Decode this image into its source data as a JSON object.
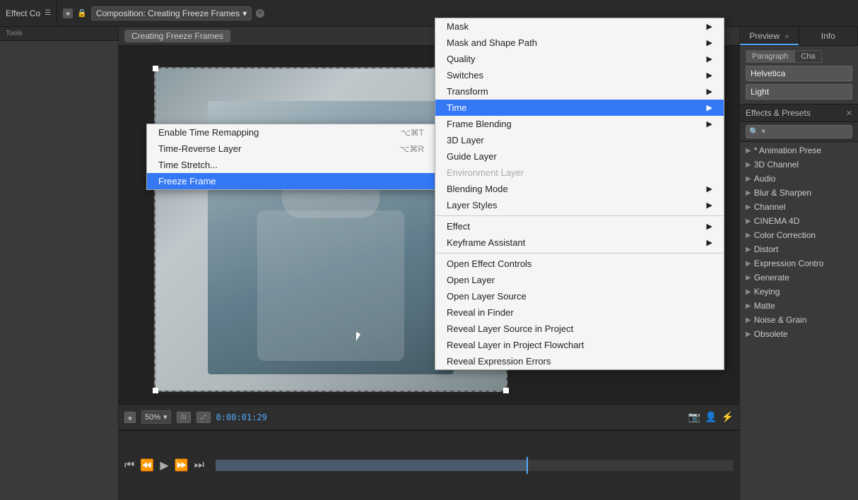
{
  "app": {
    "title": "Effect Co",
    "panel_menu_icon": "☰"
  },
  "top_bar": {
    "comp_icon_color": "#555",
    "lock_symbol": "🔒",
    "composition_name": "Composition: Creating Freeze Frames",
    "dropdown_arrow": "▾",
    "close_symbol": "✕"
  },
  "comp_tab": {
    "label": "Creating Freeze Frames"
  },
  "canvas": {
    "zoom_label": "50%",
    "timecode": "0:00:01:29",
    "camera_symbol": "📷",
    "person_symbol": "👤",
    "motion_symbol": "⚡"
  },
  "right_panel": {
    "tabs": [
      {
        "id": "preview",
        "label": "Preview",
        "has_close": true
      },
      {
        "id": "info",
        "label": "Info",
        "has_close": false
      }
    ],
    "font_tabs": [
      {
        "id": "paragraph",
        "label": "Paragraph"
      },
      {
        "id": "character",
        "label": "Cha"
      }
    ],
    "font_name": "Helvetica",
    "font_weight": "Light"
  },
  "effects_presets": {
    "title": "Effects & Presets",
    "close_symbol": "✕",
    "search_icon": "🔍",
    "search_arrow": "▾",
    "items": [
      {
        "id": "animation-presets",
        "label": "* Animation Prese"
      },
      {
        "id": "3d-channel",
        "label": "3D Channel"
      },
      {
        "id": "audio",
        "label": "Audio"
      },
      {
        "id": "blur-sharpen",
        "label": "Blur & Sharpen"
      },
      {
        "id": "channel",
        "label": "Channel"
      },
      {
        "id": "cinema4d",
        "label": "CINEMA 4D"
      },
      {
        "id": "color-correction",
        "label": "Color Correction"
      },
      {
        "id": "distort",
        "label": "Distort"
      },
      {
        "id": "expression-controls",
        "label": "Expression Contro"
      },
      {
        "id": "generate",
        "label": "Generate"
      },
      {
        "id": "keying",
        "label": "Keying"
      },
      {
        "id": "matte",
        "label": "Matte"
      },
      {
        "id": "noise-grain",
        "label": "Noise & Grain"
      },
      {
        "id": "obsolete",
        "label": "Obsolete"
      }
    ]
  },
  "context_menu1": {
    "items": [
      {
        "id": "enable-time-remapping",
        "label": "Enable Time Remapping",
        "shortcut": "⌥⌘T",
        "disabled": false,
        "has_submenu": false
      },
      {
        "id": "time-reverse-layer",
        "label": "Time-Reverse Layer",
        "shortcut": "⌥⌘R",
        "disabled": false,
        "has_submenu": false
      },
      {
        "id": "time-stretch",
        "label": "Time Stretch...",
        "shortcut": "",
        "disabled": false,
        "has_submenu": false
      },
      {
        "id": "freeze-frame",
        "label": "Freeze Frame",
        "shortcut": "",
        "disabled": false,
        "has_submenu": false,
        "highlighted": true
      }
    ]
  },
  "context_menu2": {
    "items": [
      {
        "id": "mask",
        "label": "Mask",
        "has_submenu": true,
        "disabled": false
      },
      {
        "id": "mask-shape-path",
        "label": "Mask and Shape Path",
        "has_submenu": true,
        "disabled": false
      },
      {
        "id": "quality",
        "label": "Quality",
        "has_submenu": true,
        "disabled": false
      },
      {
        "id": "switches",
        "label": "Switches",
        "has_submenu": true,
        "disabled": false
      },
      {
        "id": "transform",
        "label": "Transform",
        "has_submenu": true,
        "disabled": false
      },
      {
        "id": "time",
        "label": "Time",
        "has_submenu": true,
        "disabled": false,
        "highlighted": true
      },
      {
        "id": "frame-blending",
        "label": "Frame Blending",
        "has_submenu": true,
        "disabled": false
      },
      {
        "id": "3d-layer",
        "label": "3D Layer",
        "has_submenu": false,
        "disabled": false
      },
      {
        "id": "guide-layer",
        "label": "Guide Layer",
        "has_submenu": false,
        "disabled": false
      },
      {
        "id": "environment-layer",
        "label": "Environment Layer",
        "has_submenu": false,
        "disabled": true
      },
      {
        "id": "blending-mode",
        "label": "Blending Mode",
        "has_submenu": true,
        "disabled": false
      },
      {
        "id": "layer-styles",
        "label": "Layer Styles",
        "has_submenu": true,
        "disabled": false
      },
      {
        "id": "sep1",
        "label": "",
        "separator": true
      },
      {
        "id": "effect",
        "label": "Effect",
        "has_submenu": true,
        "disabled": false
      },
      {
        "id": "keyframe-assistant",
        "label": "Keyframe Assistant",
        "has_submenu": true,
        "disabled": false
      },
      {
        "id": "sep2",
        "label": "",
        "separator": true
      },
      {
        "id": "open-effect-controls",
        "label": "Open Effect Controls",
        "has_submenu": false,
        "disabled": false
      },
      {
        "id": "open-layer",
        "label": "Open Layer",
        "has_submenu": false,
        "disabled": false
      },
      {
        "id": "open-layer-source",
        "label": "Open Layer Source",
        "has_submenu": false,
        "disabled": false
      },
      {
        "id": "reveal-in-finder",
        "label": "Reveal in Finder",
        "has_submenu": false,
        "disabled": false
      },
      {
        "id": "reveal-layer-source",
        "label": "Reveal Layer Source in Project",
        "has_submenu": false,
        "disabled": false
      },
      {
        "id": "reveal-layer-flowchart",
        "label": "Reveal Layer in Project Flowchart",
        "has_submenu": false,
        "disabled": false
      },
      {
        "id": "reveal-expression-errors",
        "label": "Reveal Expression Errors",
        "has_submenu": false,
        "disabled": false
      }
    ]
  },
  "timeline": {
    "controls": [
      "⏮",
      "⏪",
      "▶",
      "⏩",
      "⏭"
    ],
    "bar_color": "#4a5a6a",
    "playhead_color": "#5af"
  }
}
